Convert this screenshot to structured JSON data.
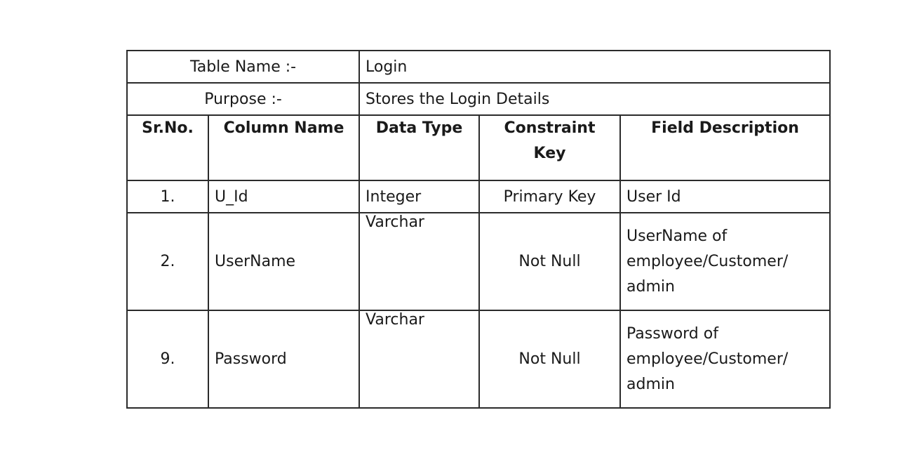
{
  "table": {
    "name_label": "Table Name :-",
    "name_value": "Login",
    "purpose_label": "Purpose :-",
    "purpose_value": "Stores the Login Details",
    "columns": [
      "Sr.No.",
      "Column Name",
      "Data Type",
      "Constraint Key",
      "Field Description"
    ],
    "rows": [
      {
        "sr": "1.",
        "column": "U_Id",
        "type": "Integer",
        "constraint": "Primary Key",
        "description": "User Id"
      },
      {
        "sr": "2.",
        "column": "UserName",
        "type": "Varchar",
        "constraint": "Not Null",
        "description": "UserName of employee/Customer/ admin"
      },
      {
        "sr": "9.",
        "column": "Password",
        "type": "Varchar",
        "constraint": "Not Null",
        "description": "Password of employee/Customer/ admin"
      }
    ]
  }
}
